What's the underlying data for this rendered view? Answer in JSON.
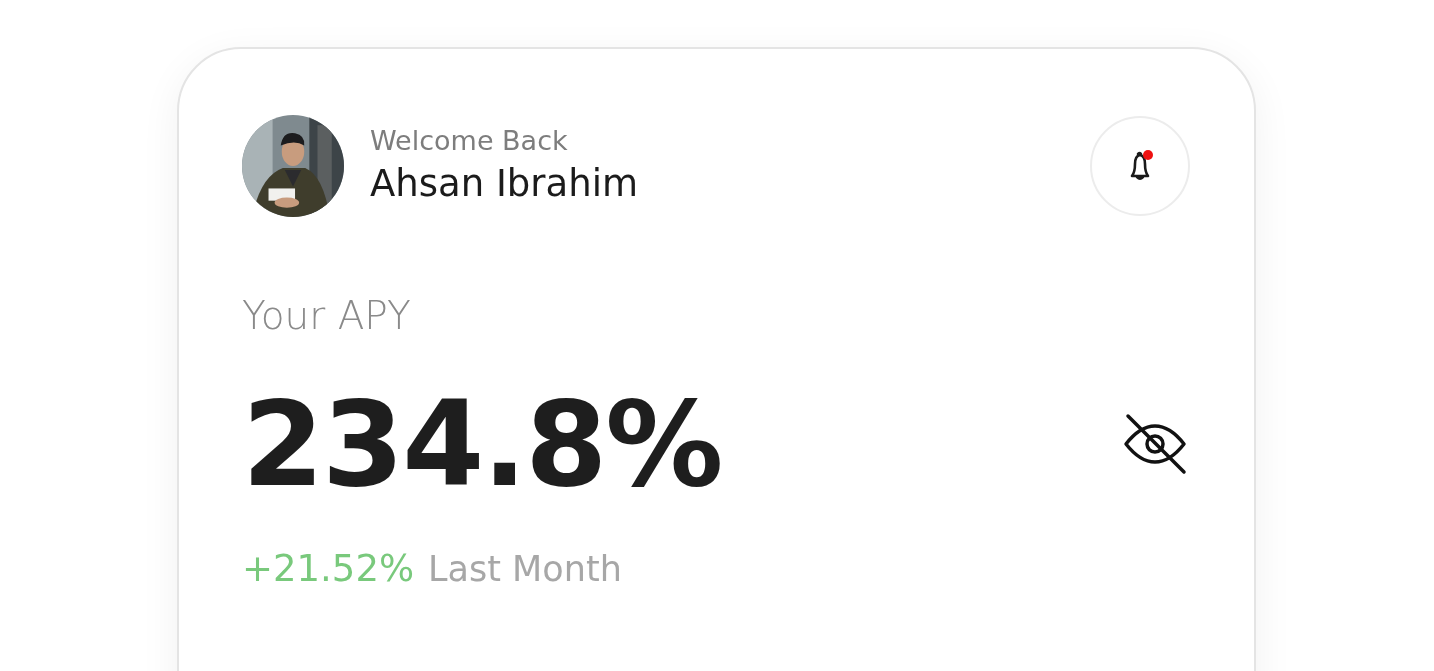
{
  "profile": {
    "greeting": "Welcome Back",
    "name": "Ahsan Ibrahim"
  },
  "notifications": {
    "unread": true
  },
  "apy": {
    "label": "Your APY",
    "value": "234.8%",
    "hidden": true,
    "change": "+21.52%",
    "change_period": "Last Month"
  }
}
